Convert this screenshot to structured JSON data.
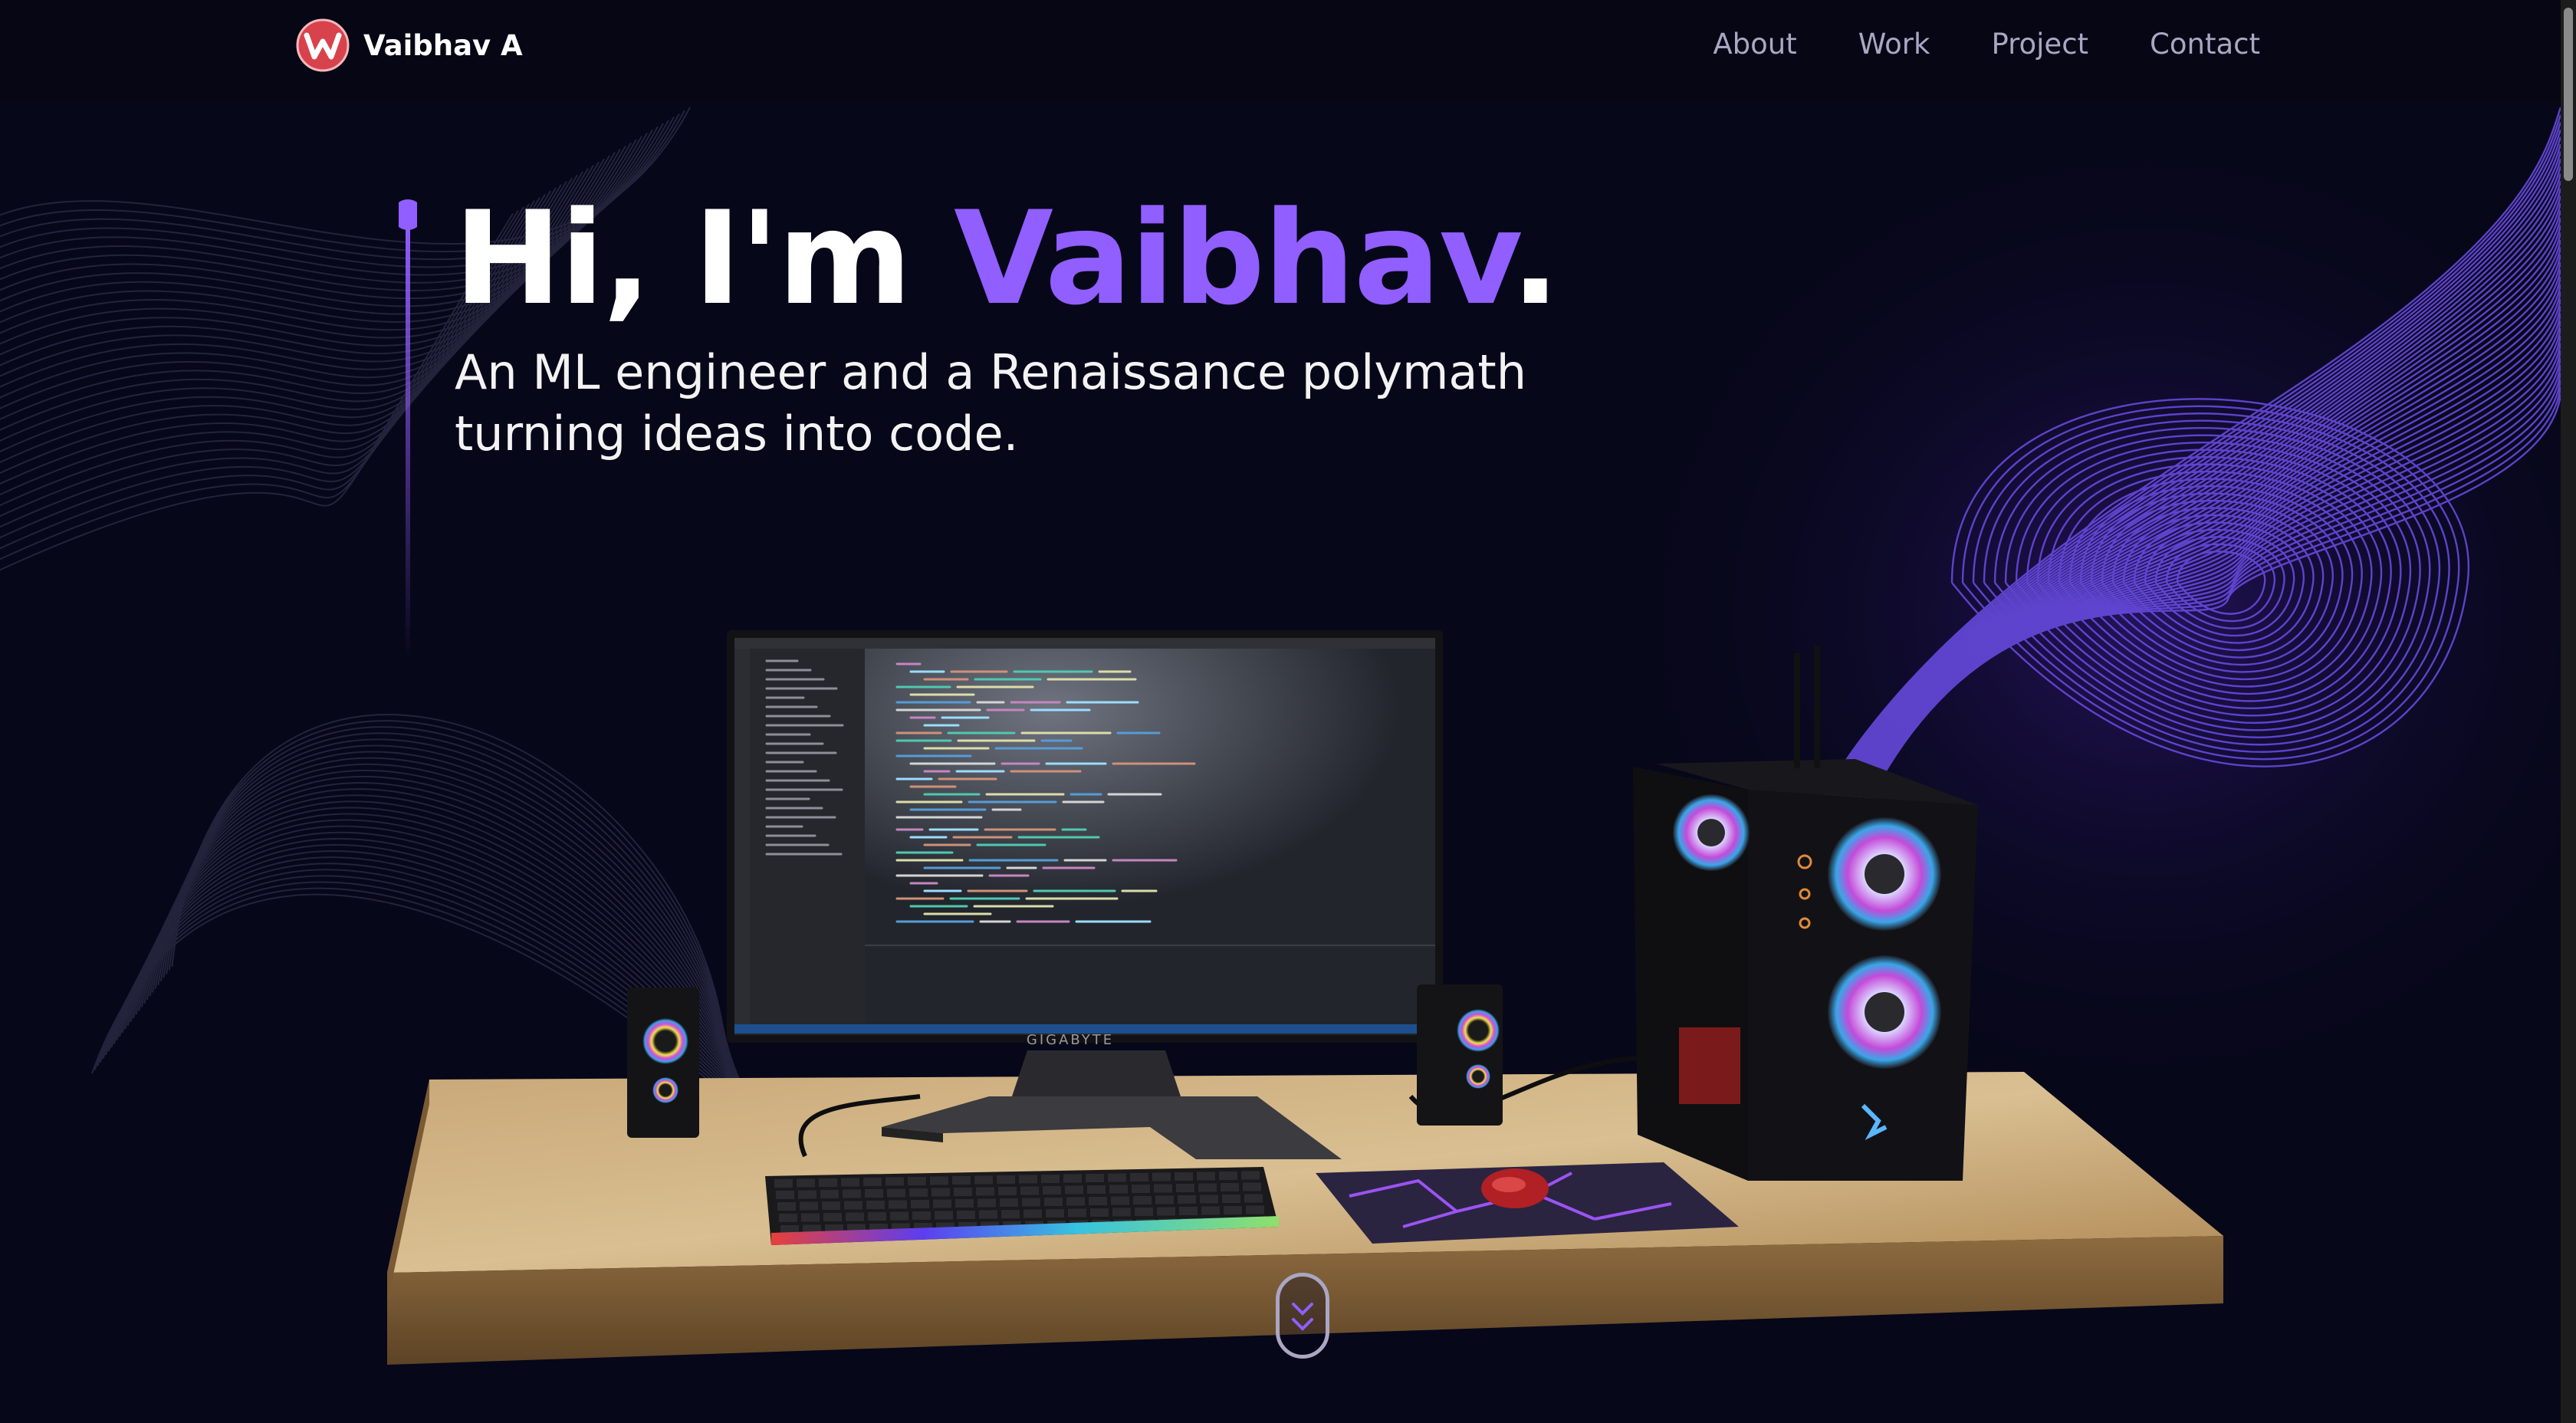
{
  "navbar": {
    "brand_name": "Vaibhav A",
    "logo_icon": "w-logo-icon",
    "links": [
      {
        "label": "About"
      },
      {
        "label": "Work"
      },
      {
        "label": "Project"
      },
      {
        "label": "Contact"
      }
    ]
  },
  "hero": {
    "title_prefix": "Hi, I'm ",
    "title_name": "Vaibhav",
    "title_suffix": ".",
    "subtitle_line1": "An ML engineer and a Renaissance polymath",
    "subtitle_line2": "turning ideas into code."
  },
  "scene": {
    "monitor_brand": "GIGABYTE",
    "description_icon": "desktop-pc-3d-model"
  },
  "scroll_indicator": {
    "icon": "chevron-double-down-icon"
  },
  "colors": {
    "background": "#07071a",
    "accent": "#915eff",
    "nav_text": "#aaa6c3",
    "logo_red": "#d8424c"
  }
}
